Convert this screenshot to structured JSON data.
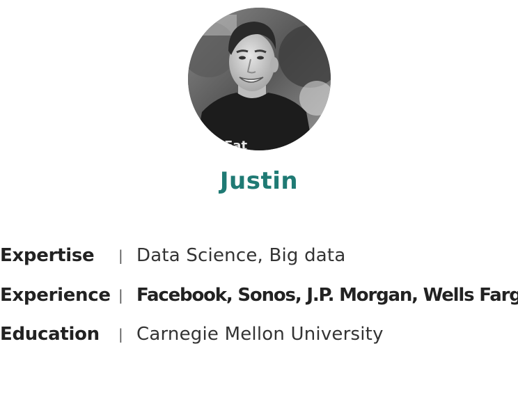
{
  "profile": {
    "name": "Justin",
    "avatar_alt": "profile-photo",
    "shirt_text": "Eat"
  },
  "details": [
    {
      "label": "Expertise",
      "separator": "|",
      "value": "Data Science, Big data"
    },
    {
      "label": "Experience",
      "separator": "|",
      "value": "Facebook, Sonos, J.P. Morgan, Wells Fargo"
    },
    {
      "label": "Education",
      "separator": "|",
      "value": "Carnegie Mellon University"
    }
  ],
  "colors": {
    "name": "#1f7a74",
    "label": "#222222",
    "value": "#333333"
  }
}
